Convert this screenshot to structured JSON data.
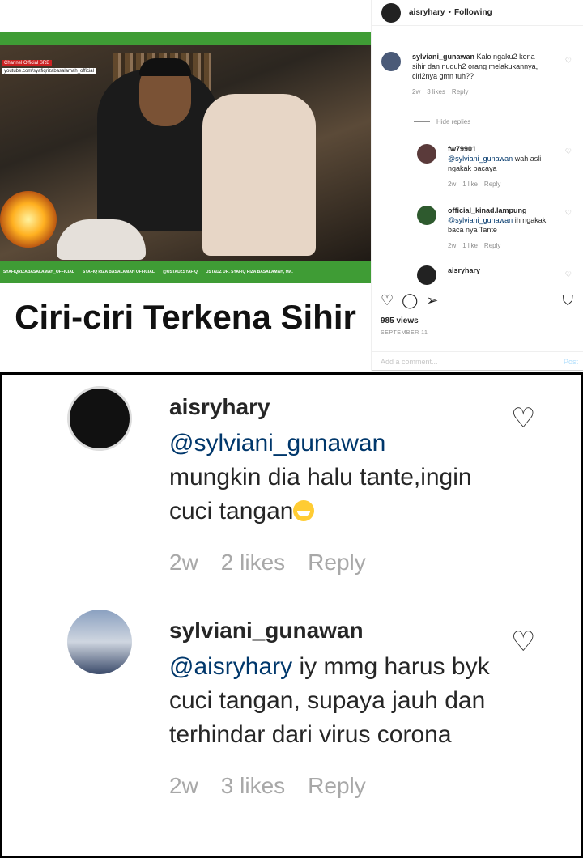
{
  "post": {
    "owner": "aisryhary",
    "follow_status": "Following",
    "headline": "Ciri-ciri Terkena Sihir",
    "channel_badge": "Channel Official SRB",
    "channel_url": "youtube.com/syafiqrizabasalamah_official",
    "social_bar": [
      "SYAFIQRIZABASALAMAH_OFFICIAL",
      "SYAFIQ RIZA BASALAMAH OFFICIAL",
      "@USTADZSYAFIQ",
      "USTADZ DR. SYAFIQ RIZA BASALAMAH, MA."
    ],
    "views": "985 views",
    "date": "SEPTEMBER 11",
    "add_comment_placeholder": "Add a comment...",
    "post_label": "Post"
  },
  "sidebar_comments": [
    {
      "user": "sylviani_gunawan",
      "text": "Kalo ngaku2 kena sihir dan nuduh2 orang melakukannya, ciri2nya gmn tuh??",
      "age": "2w",
      "likes": "3 likes",
      "reply": "Reply"
    },
    {
      "user": "fw79901",
      "mention": "@sylviani_gunawan",
      "text": "wah asli ngakak bacaya",
      "age": "2w",
      "likes": "1 like",
      "reply": "Reply"
    },
    {
      "user": "official_kinad.lampung",
      "mention": "@sylviani_gunawan",
      "text": "ih ngakak baca nya Tante",
      "age": "2w",
      "likes": "1 like",
      "reply": "Reply"
    },
    {
      "user": "aisryhary"
    }
  ],
  "hide_replies": "Hide replies",
  "zoom_comments": [
    {
      "user": "aisryhary",
      "mention": "@sylviani_gunawan",
      "text": "mungkin dia halu tante,ingin cuci tangan",
      "emoji": "grinning-face-emoji",
      "age": "2w",
      "likes": "2 likes",
      "reply": "Reply"
    },
    {
      "user": "sylviani_gunawan",
      "mention": "@aisryhary",
      "text": "iy mmg harus byk cuci tangan, supaya jauh dan terhindar dari virus corona",
      "age": "2w",
      "likes": "3 likes",
      "reply": "Reply"
    }
  ],
  "colors": {
    "accent_green": "#3f9c35",
    "link": "#00376b",
    "muted": "#8e8e8e"
  }
}
